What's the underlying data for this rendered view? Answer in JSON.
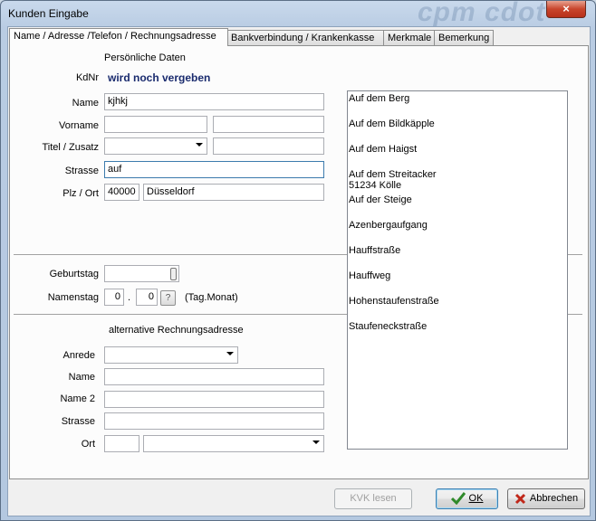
{
  "window": {
    "title": "Kunden Eingabe",
    "brand_watermark": "cpm cdot",
    "close_symbol": "×"
  },
  "tabs": [
    {
      "label": "Name / Adresse /Telefon / Rechnungsadresse",
      "active": true
    },
    {
      "label": "Bankverbindung / Krankenkasse",
      "active": false
    },
    {
      "label": "Merkmale",
      "active": false
    },
    {
      "label": "Bemerkung",
      "active": false
    }
  ],
  "personal": {
    "section_title": "Persönliche Daten",
    "kdnr_label": "KdNr",
    "kdnr_value": "wird noch vergeben",
    "name_label": "Name",
    "name_value": "kjhkj",
    "vorname_label": "Vorname",
    "vorname_value": "",
    "vorname2_value": "",
    "titel_label": "Titel / Zusatz",
    "titel_value": "",
    "zusatz_value": "",
    "strasse_label": "Strasse",
    "strasse_value": "auf",
    "plz_ort_label": "Plz / Ort",
    "plz_value": "40000",
    "ort_value": "Düsseldorf"
  },
  "dates": {
    "geburtstag_label": "Geburtstag",
    "geburtstag_value": "",
    "namenstag_label": "Namenstag",
    "tag_value": "0",
    "dot": ".",
    "monat_value": "0",
    "help_symbol": "?",
    "format_hint": "(Tag.Monat)"
  },
  "alt_address": {
    "section_title": "alternative Rechnungsadresse",
    "anrede_label": "Anrede",
    "anrede_value": "",
    "name_label": "Name",
    "name_value": "",
    "name2_label": "Name 2",
    "name2_value": "",
    "strasse_label": "Strasse",
    "strasse_value": "",
    "ort_label": "Ort",
    "plz_value": "",
    "ort_value": ""
  },
  "street_suggestions": [
    "Auf dem Berg",
    "Auf dem Bildkäpple",
    "Auf dem Haigst",
    "Auf dem Streitacker\n51234 Kölle",
    "Auf der Steige",
    "Azenbergaufgang",
    "Hauffstraße",
    "Hauffweg",
    "Hohenstaufenstraße",
    "Staufeneckstraße"
  ],
  "buttons": {
    "kvk_lesen": "KVK lesen",
    "ok": "OK",
    "abbrechen": "Abbrechen"
  },
  "colors": {
    "kdnr_text": "#1a2b6e",
    "ok_check": "#2f8a2a",
    "cancel_x": "#c0281a"
  }
}
